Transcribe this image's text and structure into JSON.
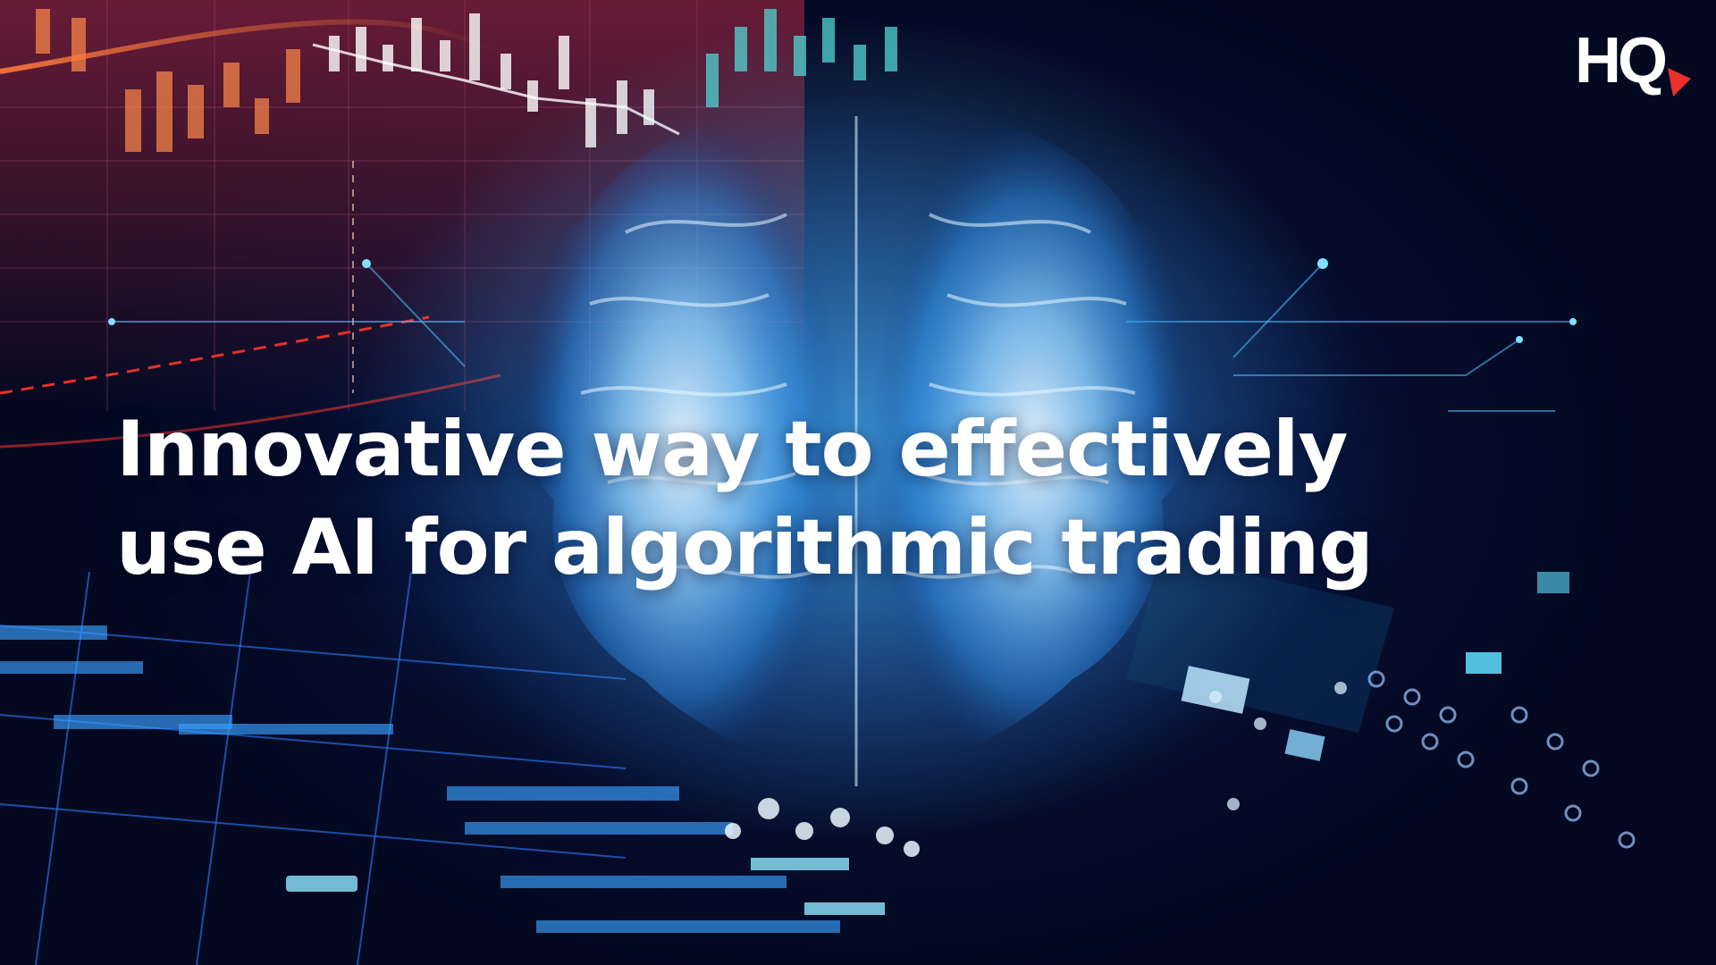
{
  "headline": {
    "line1": "Innovative way to effectively",
    "line2": "use AI for algorithmic trading"
  },
  "logo": {
    "text": "HQ",
    "text_color": "#ffffff",
    "accent_color": "#e8312b"
  },
  "palette": {
    "background": "#050a22",
    "glow": "#4fc3ff",
    "chart_warm": "#ff7a3c",
    "chart_red": "#e8312b"
  },
  "scene_icons": [
    "brain-hologram",
    "stock-candlestick-chart",
    "circuit-board"
  ]
}
